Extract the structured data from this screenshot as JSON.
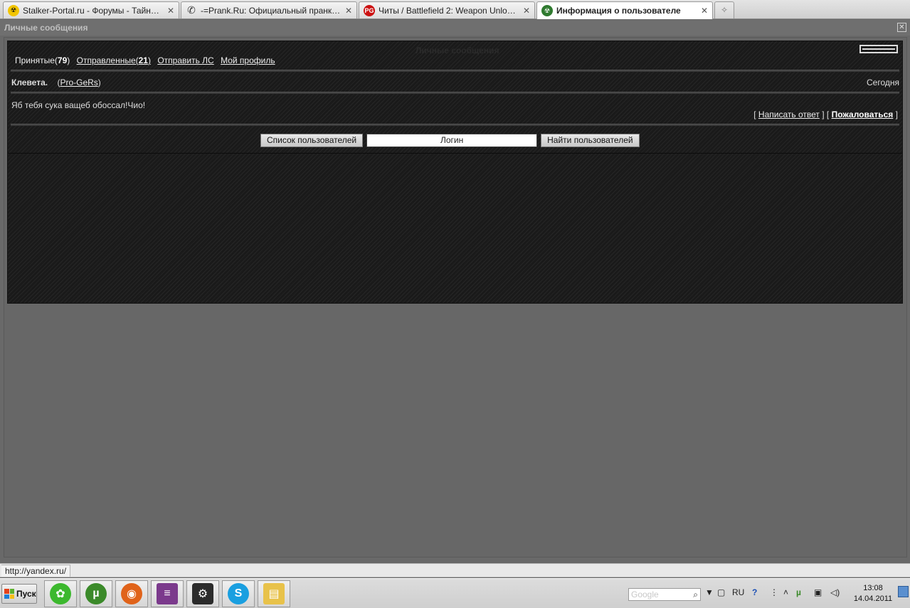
{
  "browser": {
    "tabs": [
      {
        "title": "Stalker-Portal.ru - Форумы - Тайные Т...",
        "icon": "radiation-icon",
        "color": "#f2c500"
      },
      {
        "title": "-=Prank.Ru: Официальный пранк-сай...",
        "icon": "phone-icon",
        "color": "#333333"
      },
      {
        "title": "Читы / Battlefield 2: Weapon Unlocker ...",
        "icon": "game-icon",
        "color": "#cc1111"
      },
      {
        "title": "Информация о пользователе",
        "icon": "stalker-icon",
        "color": "#2f7a2f"
      }
    ],
    "close_glyph": "✕",
    "new_tab_glyph": "✧"
  },
  "window": {
    "title": "Личные сообщения",
    "close_glyph": "✕",
    "ghost_title": "Личные сообщения"
  },
  "nav": {
    "received_label": "Принятые(",
    "received_count": "79",
    "sent_label": "Отправленные(",
    "sent_count": "21",
    "close_paren": ")",
    "send_pm": "Отправить ЛС",
    "my_profile": "Мой профиль"
  },
  "message": {
    "subject": "Клевета.",
    "author_open": "(",
    "author": "Pro-GeRs",
    "author_close": ")",
    "date": "Сегодня",
    "body": "Яб тебя сука ващеб обоссал!Чио!",
    "reply_label": "Написать ответ",
    "complain_label": "Пожаловаться",
    "bracket_open": "[",
    "bracket_mid": "] [",
    "bracket_close": "]"
  },
  "search": {
    "user_list_button": "Список пользователей",
    "login_value": "Логин",
    "find_users_button": "Найти пользователей"
  },
  "statusbar": {
    "url": "http://yandex.ru/"
  },
  "taskbar": {
    "start_label": "Пуск",
    "apps": [
      {
        "icon": "icq-icon",
        "color": "#3cb82e"
      },
      {
        "icon": "utorrent-icon",
        "color": "#3b8a2a"
      },
      {
        "icon": "firefox-icon",
        "color": "#e0631a"
      },
      {
        "icon": "winrar-icon",
        "color": "#7b3a8c"
      },
      {
        "icon": "steam-icon",
        "color": "#2b2b2b"
      },
      {
        "icon": "skype-icon",
        "color": "#1a9fe0"
      },
      {
        "icon": "folder-icon",
        "color": "#e8c24a"
      }
    ],
    "google_placeholder": "Google",
    "language": "RU",
    "time": "13:08",
    "date": "14.04.2011"
  }
}
